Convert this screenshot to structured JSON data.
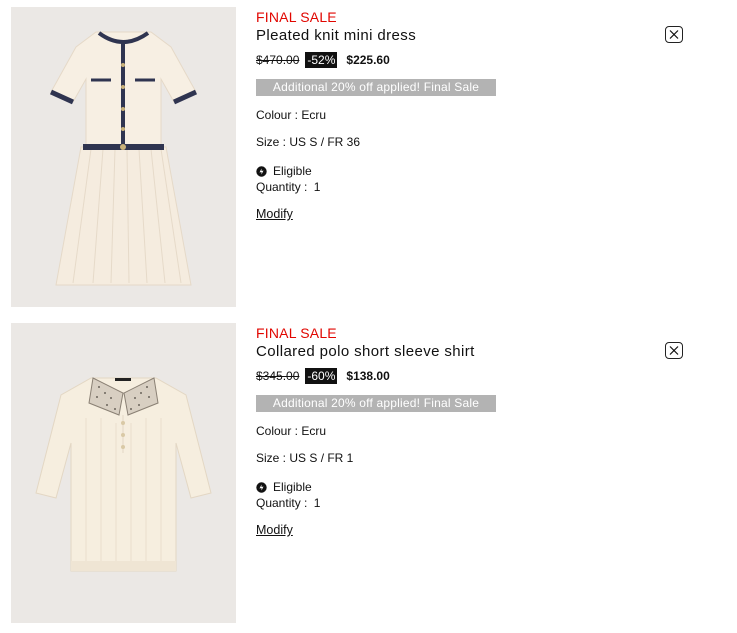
{
  "colors": {
    "final_sale": "#e10600",
    "promo_bg": "#b3b3b3",
    "discount_bg": "#111111",
    "thumb_bg": "#ebe8e5"
  },
  "items": [
    {
      "final_sale_label": "FINAL SALE",
      "name": "Pleated knit mini dress",
      "original_price": "$470.00",
      "discount": "-52%",
      "sale_price": "$225.60",
      "promo_text": "Additional 20% off applied! Final Sale",
      "colour_text": "Colour : Ecru",
      "size_text": "Size : US S / FR 36",
      "eligible_text": "Eligible",
      "quantity_label": "Quantity :",
      "quantity_value": "1",
      "modify_label": "Modify",
      "image_icon": "dress-image",
      "remove_icon": "close-icon"
    },
    {
      "final_sale_label": "FINAL SALE",
      "name": "Collared polo short sleeve shirt",
      "original_price": "$345.00",
      "discount": "-60%",
      "sale_price": "$138.00",
      "promo_text": "Additional 20% off applied! Final Sale",
      "colour_text": "Colour : Ecru",
      "size_text": "Size : US S / FR 1",
      "eligible_text": "Eligible",
      "quantity_label": "Quantity :",
      "quantity_value": "1",
      "modify_label": "Modify",
      "image_icon": "shirt-image",
      "remove_icon": "close-icon"
    }
  ]
}
